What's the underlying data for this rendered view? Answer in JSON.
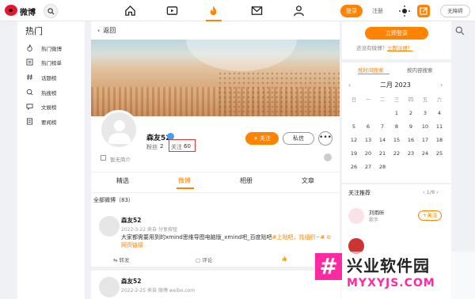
{
  "topbar": {
    "logo_text": "微博",
    "login_label": "登录",
    "register_label": "注册",
    "barrier_free_label": "无障碍"
  },
  "sidebar": {
    "title": "热门",
    "items": [
      {
        "label": "热门微博",
        "icon": "flame-icon"
      },
      {
        "label": "热门榜单",
        "icon": "ranking-icon"
      },
      {
        "label": "话题榜",
        "icon": "hashtag-icon"
      },
      {
        "label": "热搜榜",
        "icon": "hot-search-icon"
      },
      {
        "label": "文娱榜",
        "icon": "entertainment-icon"
      },
      {
        "label": "要闻榜",
        "icon": "news-icon"
      }
    ]
  },
  "profile": {
    "back_label": "返回",
    "username": "森友52",
    "fans_label": "粉丝",
    "fans_count": "2",
    "following_label": "关注",
    "following_count": "60",
    "follow_button": "+ 关注",
    "message_button": "私信",
    "more_button": "•••",
    "intro": "暂无简介",
    "tabs": [
      "精选",
      "微博",
      "相册",
      "文章"
    ],
    "active_tab": "微博",
    "filter_label": "全部微博（83）"
  },
  "posts": [
    {
      "name": "森友52",
      "meta": "2022-3-22 来自 分享按钮",
      "body_plain": "大家都需要用到的xmind思维导图电脑版_xmind吧_百度贴吧",
      "body_highlight": "#上贴吧，找组织~# ⊘网页链接",
      "repost": "转发",
      "comment": "评论"
    },
    {
      "name": "森友52",
      "meta": "2022-2-25 来自 微博 weibo.com"
    }
  ],
  "right": {
    "now_login": "立即登录",
    "no_account": "还没有微博？",
    "register_now": "立即注册！",
    "cal_tab1": "按时间搜索",
    "cal_tab2": "按内容搜索",
    "cal_title": "二月 2023",
    "weekdays": [
      "日",
      "一",
      "二",
      "三",
      "四",
      "五",
      "六"
    ],
    "days": [
      [
        "",
        "",
        "",
        "1",
        "2",
        "3",
        "4"
      ],
      [
        "5",
        "6",
        "7",
        "8",
        "9",
        "10",
        "11"
      ],
      [
        "12",
        "13",
        "14",
        "15",
        "16",
        "17",
        "18"
      ],
      [
        "19",
        "20",
        "21",
        "22",
        "23",
        "24",
        "25"
      ],
      [
        "26",
        "27",
        "28",
        "",
        "",
        "",
        ""
      ]
    ],
    "rec_title": "关注推荐",
    "rec_pager": "1/8",
    "rec_name": "刘雨昕",
    "rec_desc": "歌手",
    "rec_button": "+关注"
  },
  "watermark": {
    "line1": "兴业软件园",
    "line2": "MYXYJS.COM",
    "mark": "#"
  },
  "colors": {
    "accent": "#ff8200",
    "brand_red": "#e6162d"
  }
}
